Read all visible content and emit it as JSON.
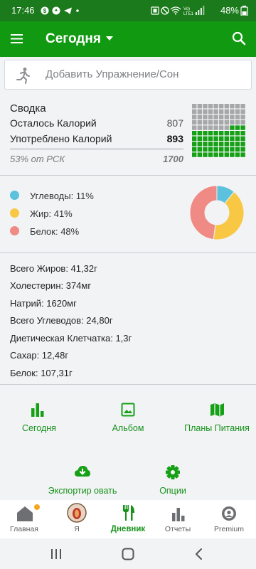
{
  "colors": {
    "status_bar": "#1b7a1b",
    "app_bar": "#119a11",
    "accent_green": "#16a016",
    "carbs": "#5bc1dc",
    "fat": "#f8c744",
    "protein": "#f08a85",
    "grid_empty": "#a7a8aa",
    "notification_dot": "#f5a623"
  },
  "status_bar": {
    "time": "17:46",
    "network": "Vo) LTE1",
    "battery": "48%"
  },
  "app_bar": {
    "title": "Сегодня",
    "menu_icon": "hamburger-icon",
    "search_icon": "search-icon"
  },
  "exercise": {
    "icon": "running-icon",
    "label": "Добавить Упражнение/Сон"
  },
  "summary": {
    "heading": "Сводка",
    "remaining_label": "Осталось Калорий",
    "remaining_value": "807",
    "consumed_label": "Употреблено Калорий",
    "consumed_value": "893",
    "percent_label": "53% от РСК",
    "rsk_value": "1700",
    "filled_fraction": 0.53
  },
  "macros": [
    {
      "label": "Углеводы: 11%",
      "percent": 11,
      "color": "#5bc1dc"
    },
    {
      "label": "Жир: 41%",
      "percent": 41,
      "color": "#f8c744"
    },
    {
      "label": "Белок: 48%",
      "percent": 48,
      "color": "#f08a85"
    }
  ],
  "nutrients": [
    "Всего Жиров: 41,32г",
    "Холестерин: 374мг",
    "Натрий: 1620мг",
    "Всего Углеводов: 24,80г",
    "Диетическая Клетчатка: 1,3г",
    "Сахар: 12,48г",
    "Белок: 107,31г"
  ],
  "actions": [
    {
      "label": "Сегодня",
      "icon": "bar-chart-icon"
    },
    {
      "label": "Альбом",
      "icon": "image-icon"
    },
    {
      "label": "Планы Питания",
      "icon": "map-icon"
    },
    {
      "label": "Экспортир овать",
      "icon": "cloud-download-icon"
    },
    {
      "label": "Опции",
      "icon": "gear-icon"
    }
  ],
  "bottom_nav": [
    {
      "label": "Главная",
      "icon": "home-icon",
      "active": false,
      "badge": true
    },
    {
      "label": "Я",
      "icon": "avatar-icon",
      "active": false
    },
    {
      "label": "Дневник",
      "icon": "cutlery-icon",
      "active": true
    },
    {
      "label": "Отчеты",
      "icon": "bar-chart-icon",
      "active": false
    },
    {
      "label": "Premium",
      "icon": "premium-icon",
      "active": false
    }
  ],
  "system_nav": [
    "recents-button",
    "home-button",
    "back-button"
  ]
}
